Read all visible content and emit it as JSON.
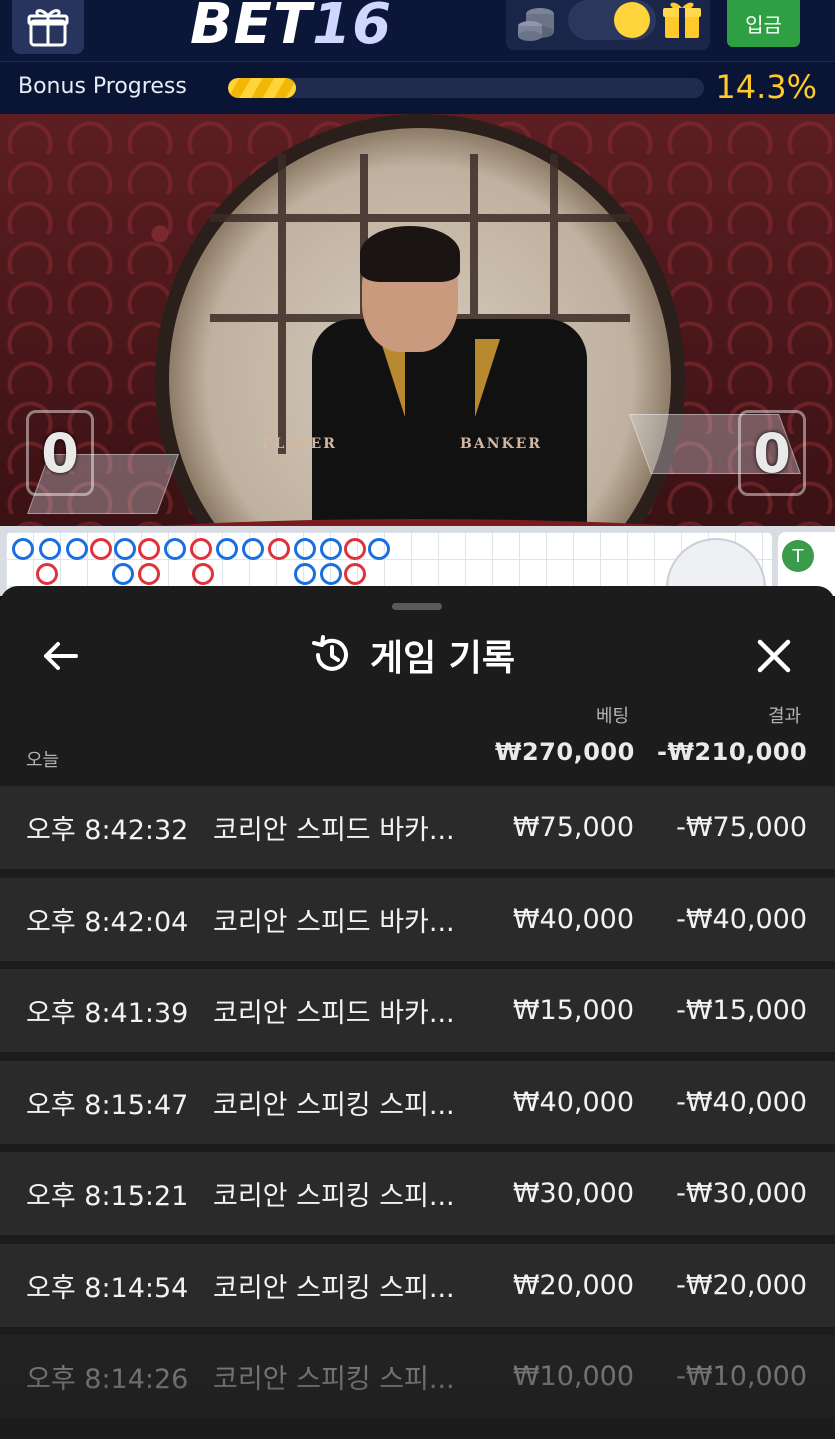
{
  "header": {
    "logo_text": "BET",
    "logo_number": "16",
    "deposit_label": "입금",
    "icons": [
      "gift-outline-icon",
      "coins-icon",
      "toggle",
      "gift-icon"
    ]
  },
  "bonus": {
    "label": "Bonus Progress",
    "percent_text": "14.3%",
    "progress_fraction": 0.143
  },
  "video": {
    "table_player_label": "PLAYER",
    "table_banker_label": "BANKER",
    "player_score": "0",
    "banker_score": "0"
  },
  "roadmap": {
    "side_letter": "T"
  },
  "sheet": {
    "title": "게임 기록",
    "summary": {
      "today_label": "오늘",
      "bet_header": "베팅",
      "result_header": "결과",
      "bet_total": "₩270,000",
      "result_total": "-₩210,000"
    },
    "rows": [
      {
        "time": "오후 8:42:32",
        "game": "코리안 스피드 바카...",
        "bet": "₩75,000",
        "result": "-₩75,000"
      },
      {
        "time": "오후 8:42:04",
        "game": "코리안 스피드 바카...",
        "bet": "₩40,000",
        "result": "-₩40,000"
      },
      {
        "time": "오후 8:41:39",
        "game": "코리안 스피드 바카...",
        "bet": "₩15,000",
        "result": "-₩15,000"
      },
      {
        "time": "오후 8:15:47",
        "game": "코리안 스피킹 스피...",
        "bet": "₩40,000",
        "result": "-₩40,000"
      },
      {
        "time": "오후 8:15:21",
        "game": "코리안 스피킹 스피...",
        "bet": "₩30,000",
        "result": "-₩30,000"
      },
      {
        "time": "오후 8:14:54",
        "game": "코리안 스피킹 스피...",
        "bet": "₩20,000",
        "result": "-₩20,000"
      },
      {
        "time": "오후 8:14:26",
        "game": "코리안 스피킹 스피...",
        "bet": "₩10,000",
        "result": "-₩10,000"
      }
    ]
  },
  "colors": {
    "header_bg": "#0b1638",
    "deposit_green": "#2ea043",
    "bonus_yellow": "#ffc929",
    "sheet_bg": "#1c1c1c",
    "row_bg": "#2a2a2a"
  }
}
